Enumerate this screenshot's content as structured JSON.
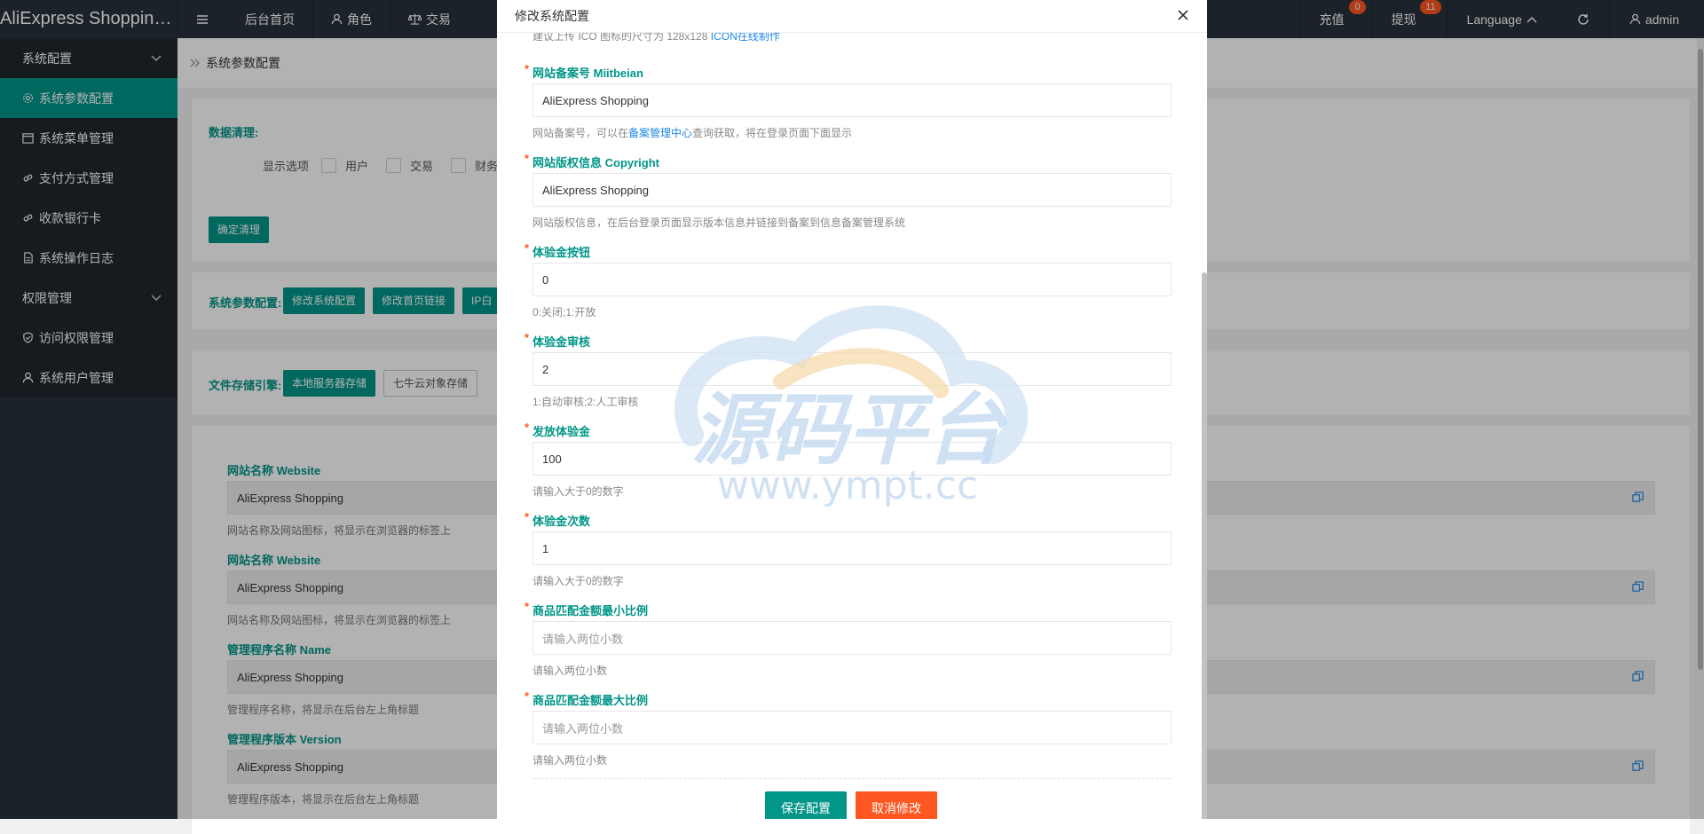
{
  "app": {
    "title": "AliExpress Shopping..."
  },
  "topnav": {
    "menu_icon": "hamburger-icon",
    "items": [
      {
        "label": "后台首页",
        "icon": ""
      },
      {
        "label": "角色",
        "icon": "user-icon"
      },
      {
        "label": "交易",
        "icon": "scale-icon"
      }
    ],
    "right": {
      "recharge": {
        "label": "充值",
        "badge": "0"
      },
      "withdraw": {
        "label": "提现",
        "badge": "11"
      },
      "language": {
        "label": "Language"
      },
      "refresh_icon": "refresh-icon",
      "user": {
        "label": "admin"
      }
    }
  },
  "sidebar": {
    "group1": "系统配置",
    "items1": [
      {
        "label": "系统参数配置",
        "icon": "gear-icon"
      },
      {
        "label": "系统菜单管理",
        "icon": "calendar-icon"
      },
      {
        "label": "支付方式管理",
        "icon": "link-icon"
      },
      {
        "label": "收款银行卡",
        "icon": "link-icon"
      },
      {
        "label": "系统操作日志",
        "icon": "file-icon"
      }
    ],
    "group2": "权限管理",
    "items2": [
      {
        "label": "访问权限管理",
        "icon": "shield-icon"
      },
      {
        "label": "系统用户管理",
        "icon": "user-icon"
      }
    ]
  },
  "breadcrumb": {
    "label": "系统参数配置"
  },
  "cleanup": {
    "title": "数据清理:",
    "options_label": "显示选项",
    "options": [
      "用户",
      "交易",
      "财务"
    ],
    "confirm": "确定清理"
  },
  "sysparams": {
    "title": "系统参数配置:",
    "buttons": [
      "修改系统配置",
      "修改首页链接",
      "IP白"
    ]
  },
  "storage": {
    "title": "文件存储引擎:",
    "buttons": [
      "本地服务器存储",
      "七牛云对象存储"
    ]
  },
  "bgfields": [
    {
      "label": "网站名称 Website",
      "value": "AliExpress Shopping",
      "hint": "网站名称及网站图标，将显示在浏览器的标签上"
    },
    {
      "label": "网站名称 Website",
      "value": "AliExpress Shopping",
      "hint": "网站名称及网站图标，将显示在浏览器的标签上"
    },
    {
      "label": "管理程序名称 Name",
      "value": "AliExpress Shopping",
      "hint": "管理程序名称，将显示在后台左上角标题"
    },
    {
      "label": "管理程序版本 Version",
      "value": "AliExpress Shopping",
      "hint": "管理程序版本，将显示在后台左上角标题"
    }
  ],
  "modal": {
    "title": "修改系统配置",
    "top_hint_prefix": "建议上传 ICO 图标的尺寸为 128x128",
    "top_hint_link": "ICON在线制作",
    "fields": [
      {
        "label": "网站备案号 Miitbeian",
        "value": "AliExpress Shopping",
        "placeholder": "",
        "hint_prefix": "网站备案号，可以在",
        "hint_link": "备案管理中心",
        "hint_suffix": "查询获取，将在登录页面下面显示"
      },
      {
        "label": "网站版权信息 Copyright",
        "value": "AliExpress Shopping",
        "placeholder": "",
        "hint_prefix": "网站版权信息，在后台登录页面显示版本信息并链接到备案到信息备案管理系统",
        "hint_link": "",
        "hint_suffix": ""
      },
      {
        "label": "体验金按钮",
        "value": "0",
        "placeholder": "",
        "hint_prefix": "0:关闭;1:开放",
        "hint_link": "",
        "hint_suffix": ""
      },
      {
        "label": "体验金审核",
        "value": "2",
        "placeholder": "",
        "hint_prefix": "1:自动审核;2:人工审核",
        "hint_link": "",
        "hint_suffix": ""
      },
      {
        "label": "发放体验金",
        "value": "100",
        "placeholder": "",
        "hint_prefix": "请输入大于0的数字",
        "hint_link": "",
        "hint_suffix": ""
      },
      {
        "label": "体验金次数",
        "value": "1",
        "placeholder": "",
        "hint_prefix": "请输入大于0的数字",
        "hint_link": "",
        "hint_suffix": ""
      },
      {
        "label": "商品匹配金额最小比例",
        "value": "",
        "placeholder": "请输入两位小数",
        "hint_prefix": "请输入两位小数",
        "hint_link": "",
        "hint_suffix": ""
      },
      {
        "label": "商品匹配金额最大比例",
        "value": "",
        "placeholder": "请输入两位小数",
        "hint_prefix": "请输入两位小数",
        "hint_link": "",
        "hint_suffix": ""
      }
    ],
    "save": "保存配置",
    "cancel": "取消修改"
  },
  "watermark": {
    "text": "源码平台",
    "url": "www.ympt.cc"
  },
  "colors": {
    "accent": "#009688",
    "danger": "#ff5722",
    "sidebar": "#28313b",
    "link": "#1e88e5"
  }
}
